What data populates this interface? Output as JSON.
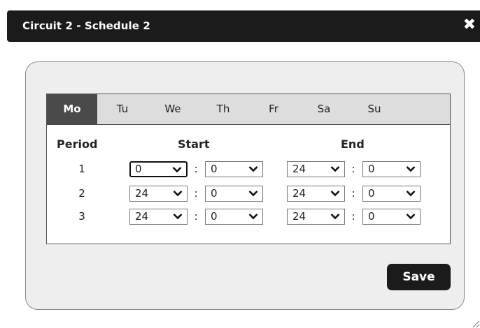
{
  "dialog": {
    "title": "Circuit 2 - Schedule 2",
    "close_label": "✖"
  },
  "days": [
    "Mo",
    "Tu",
    "We",
    "Th",
    "Fr",
    "Sa",
    "Su"
  ],
  "selected_day": "Mo",
  "headers": {
    "period": "Period",
    "start": "Start",
    "end": "End"
  },
  "colon": ":",
  "periods": [
    {
      "label": "1",
      "start_hour": "0",
      "start_min": "0",
      "end_hour": "24",
      "end_min": "0"
    },
    {
      "label": "2",
      "start_hour": "24",
      "start_min": "0",
      "end_hour": "24",
      "end_min": "0"
    },
    {
      "label": "3",
      "start_hour": "24",
      "start_min": "0",
      "end_hour": "24",
      "end_min": "0"
    }
  ],
  "save_label": "Save",
  "icons": {
    "close": "close-icon",
    "dropdown": "chevron-down-icon",
    "resize": "resize-grip-icon"
  },
  "colors": {
    "titlebar": "#1b1b1b",
    "active_tab": "#4a4a4a",
    "tab_strip": "#dddddd",
    "panel": "#eeeeee"
  }
}
